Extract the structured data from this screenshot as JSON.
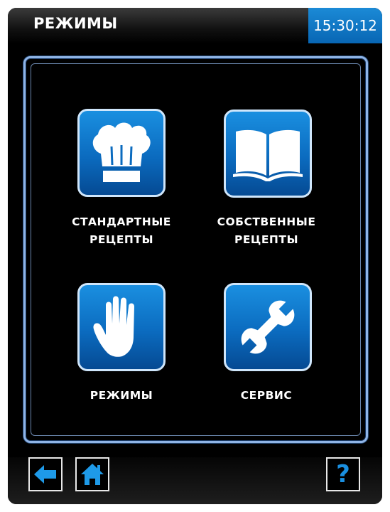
{
  "header": {
    "title": "РЕЖИМЫ",
    "clock": "15:30:12"
  },
  "menu": {
    "items": [
      {
        "label_line1": "СТАНДАРТНЫЕ",
        "label_line2": "РЕЦЕПТЫ",
        "icon": "chef-hat-icon"
      },
      {
        "label_line1": "СОБСТВЕННЫЕ",
        "label_line2": "РЕЦЕПТЫ",
        "icon": "open-book-icon"
      },
      {
        "label_line1": "РЕЖИМЫ",
        "icon": "hand-icon"
      },
      {
        "label_line1": "СЕРВИС",
        "icon": "wrench-icon"
      }
    ]
  },
  "footer": {
    "back_icon": "arrow-left-icon",
    "home_icon": "home-icon",
    "help_label": "?"
  },
  "colors": {
    "accent": "#0b74c8",
    "tile_border": "#cfe6fb",
    "panel_border": "#8fb4e6",
    "help_question": "#1a8fe0"
  }
}
